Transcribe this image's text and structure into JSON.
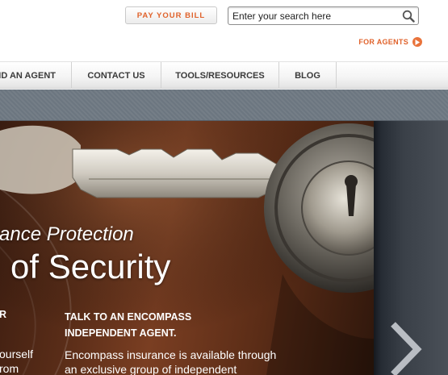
{
  "header": {
    "pay_bill_label": "PAY YOUR BILL",
    "search_placeholder": "Enter your search here",
    "for_agents_label": "FOR AGENTS"
  },
  "nav": {
    "items": [
      "ND AN AGENT",
      "CONTACT US",
      "TOOLS/RESOURCES",
      "BLOG"
    ]
  },
  "hero": {
    "subtitle": "ance Protection",
    "title": "of Security",
    "left_column": {
      "heading": "R",
      "lines": [
        "ourself",
        "rom"
      ]
    },
    "right_column": {
      "heading_line1": "TALK TO AN ENCOMPASS",
      "heading_line2": "INDEPENDENT AGENT.",
      "body_line1": "Encompass insurance is available through",
      "body_line2": "an exclusive group of independent"
    }
  },
  "colors": {
    "accent": "#e0622b",
    "nav_text": "#3a3a3a",
    "strip": "#6c7680"
  },
  "icons": {
    "search": "search-icon",
    "for_agents_arrow": "arrow-right-circle-icon",
    "carousel_next": "chevron-right-icon"
  }
}
